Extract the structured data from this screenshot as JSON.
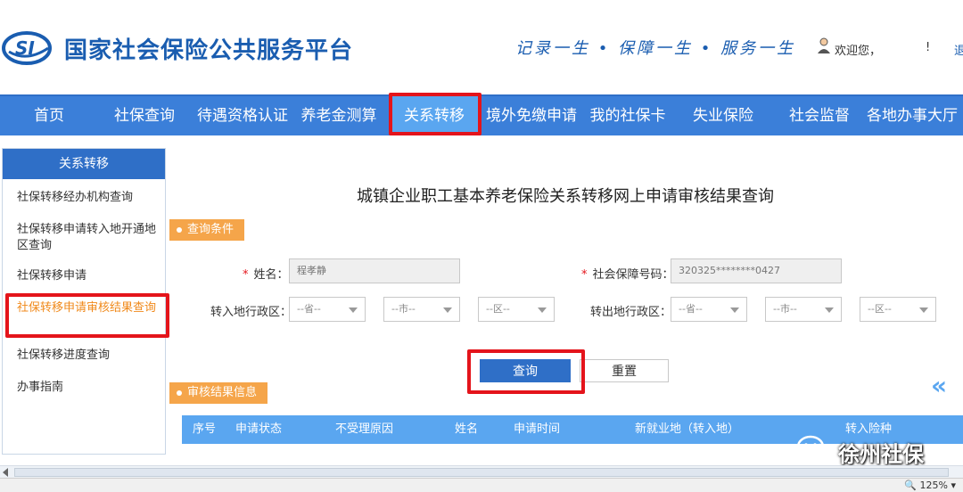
{
  "header": {
    "logo_text": "SI",
    "site_title": "国家社会保险公共服务平台",
    "slogan": "记录一生 • 保障一生 • 服务一生",
    "welcome": "欢迎您，",
    "exclaim": "!",
    "cut_link": "退"
  },
  "nav": {
    "items": [
      "首页",
      "社保查询",
      "待遇资格认证",
      "养老金测算",
      "关系转移",
      "境外免缴申请",
      "我的社保卡",
      "失业保险",
      "社会监督",
      "各地办事大厅"
    ],
    "active_index": 4
  },
  "sidebar": {
    "title": "关系转移",
    "items": [
      "社保转移经办机构查询",
      "社保转移申请转入地开通地区查询",
      "社保转移申请",
      "社保转移申请审核结果查询",
      "社保转移进度查询",
      "办事指南"
    ],
    "active_index": 3
  },
  "main": {
    "title": "城镇企业职工基本养老保险关系转移网上申请审核结果查询",
    "conditions_tag": "查询条件",
    "name_label": "姓名：",
    "name_value": "程孝静",
    "ssn_label": "社会保障号码：",
    "ssn_value": "320325********0427",
    "in_region_label": "转入地行政区：",
    "out_region_label": "转出地行政区：",
    "province_placeholder": "--省--",
    "city_placeholder": "--市--",
    "district_placeholder": "--区--",
    "query_button": "查询",
    "reset_button": "重置",
    "results_tag": "审核结果信息",
    "table_headers": [
      "序号",
      "申请状态",
      "不受理原因",
      "姓名",
      "申请时间",
      "新就业地（转入地）",
      "转入险种"
    ]
  },
  "watermark": "徐州社保",
  "status": {
    "zoom": "125%"
  },
  "colors": {
    "brand_blue": "#1a5db0",
    "nav_blue": "#3b7fd9",
    "highlight_red": "#e4141b",
    "tag_orange": "#f5a54a"
  }
}
